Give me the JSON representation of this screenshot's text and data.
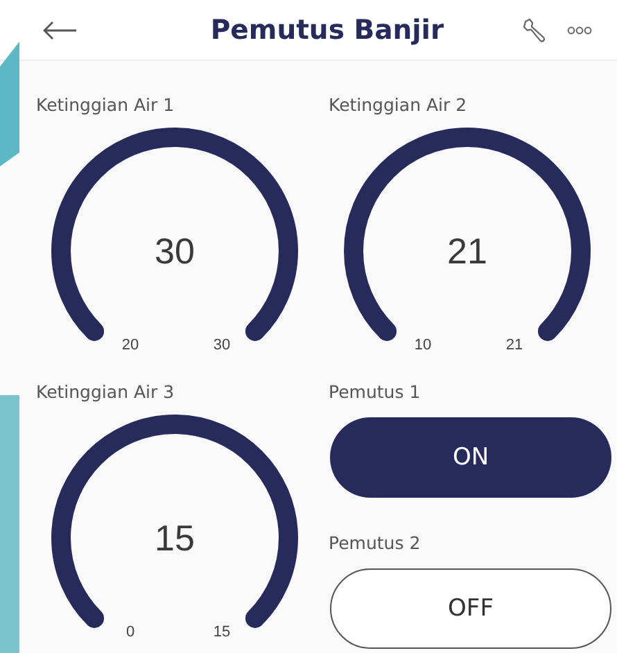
{
  "title": "Pemutus Banjir",
  "gauges": [
    {
      "label": "Ketinggian Air 1",
      "value": "30",
      "min": "20",
      "max": "30"
    },
    {
      "label": "Ketinggian Air 2",
      "value": "21",
      "min": "10",
      "max": "21"
    },
    {
      "label": "Ketinggian Air 3",
      "value": "15",
      "min": "0",
      "max": "15"
    }
  ],
  "switches": [
    {
      "label": "Pemutus 1",
      "text": "ON",
      "on": true
    },
    {
      "label": "Pemutus 2",
      "text": "OFF",
      "on": false
    }
  ]
}
